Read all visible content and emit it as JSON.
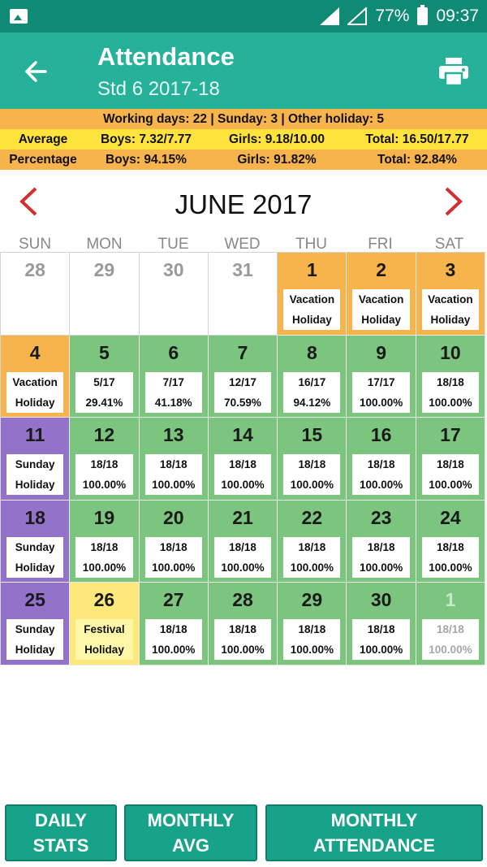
{
  "status": {
    "battery": "77%",
    "time": "09:37"
  },
  "app": {
    "title": "Attendance",
    "subtitle": "Std 6 2017-18"
  },
  "stats": {
    "summary": "Working days: 22 | Sunday: 3 | Other holiday: 5",
    "average": {
      "label": "Average",
      "boys": "Boys: 7.32/7.77",
      "girls": "Girls: 9.18/10.00",
      "total": "Total: 16.50/17.77"
    },
    "percentage": {
      "label": "Percentage",
      "boys": "Boys: 94.15%",
      "girls": "Girls: 91.82%",
      "total": "Total: 92.84%"
    }
  },
  "calendar": {
    "month": "JUNE 2017",
    "weekdays": [
      "SUN",
      "MON",
      "TUE",
      "WED",
      "THU",
      "FRI",
      "SAT"
    ],
    "colors": {
      "holiday": "#f7b44c",
      "present": "#7cc57e",
      "sunday": "#9373c9",
      "festival": "#fde97b",
      "header": "#26b29a",
      "status": "#0f8a74",
      "arrow": "#d32f2f"
    },
    "days": [
      {
        "day": "28",
        "type": "white",
        "l1": "",
        "l2": ""
      },
      {
        "day": "29",
        "type": "white",
        "l1": "",
        "l2": ""
      },
      {
        "day": "30",
        "type": "white",
        "l1": "",
        "l2": ""
      },
      {
        "day": "31",
        "type": "white",
        "l1": "",
        "l2": ""
      },
      {
        "day": "1",
        "type": "orange",
        "l1": "Vacation",
        "l2": "Holiday"
      },
      {
        "day": "2",
        "type": "orange",
        "l1": "Vacation",
        "l2": "Holiday"
      },
      {
        "day": "3",
        "type": "orange",
        "l1": "Vacation",
        "l2": "Holiday"
      },
      {
        "day": "4",
        "type": "orange",
        "l1": "Vacation",
        "l2": "Holiday"
      },
      {
        "day": "5",
        "type": "green",
        "l1": "5/17",
        "l2": "29.41%"
      },
      {
        "day": "6",
        "type": "green",
        "l1": "7/17",
        "l2": "41.18%"
      },
      {
        "day": "7",
        "type": "green",
        "l1": "12/17",
        "l2": "70.59%"
      },
      {
        "day": "8",
        "type": "green",
        "l1": "16/17",
        "l2": "94.12%"
      },
      {
        "day": "9",
        "type": "green",
        "l1": "17/17",
        "l2": "100.00%"
      },
      {
        "day": "10",
        "type": "green",
        "l1": "18/18",
        "l2": "100.00%"
      },
      {
        "day": "11",
        "type": "purple",
        "l1": "Sunday",
        "l2": "Holiday"
      },
      {
        "day": "12",
        "type": "green",
        "l1": "18/18",
        "l2": "100.00%"
      },
      {
        "day": "13",
        "type": "green",
        "l1": "18/18",
        "l2": "100.00%"
      },
      {
        "day": "14",
        "type": "green",
        "l1": "18/18",
        "l2": "100.00%"
      },
      {
        "day": "15",
        "type": "green",
        "l1": "18/18",
        "l2": "100.00%"
      },
      {
        "day": "16",
        "type": "green",
        "l1": "18/18",
        "l2": "100.00%"
      },
      {
        "day": "17",
        "type": "green",
        "l1": "18/18",
        "l2": "100.00%"
      },
      {
        "day": "18",
        "type": "purple",
        "l1": "Sunday",
        "l2": "Holiday"
      },
      {
        "day": "19",
        "type": "green",
        "l1": "18/18",
        "l2": "100.00%"
      },
      {
        "day": "20",
        "type": "green",
        "l1": "18/18",
        "l2": "100.00%"
      },
      {
        "day": "21",
        "type": "green",
        "l1": "18/18",
        "l2": "100.00%"
      },
      {
        "day": "22",
        "type": "green",
        "l1": "18/18",
        "l2": "100.00%"
      },
      {
        "day": "23",
        "type": "green",
        "l1": "18/18",
        "l2": "100.00%"
      },
      {
        "day": "24",
        "type": "green",
        "l1": "18/18",
        "l2": "100.00%"
      },
      {
        "day": "25",
        "type": "purple",
        "l1": "Sunday",
        "l2": "Holiday"
      },
      {
        "day": "26",
        "type": "yellow",
        "l1": "Festival",
        "l2": "Holiday"
      },
      {
        "day": "27",
        "type": "green",
        "l1": "18/18",
        "l2": "100.00%"
      },
      {
        "day": "28",
        "type": "green",
        "l1": "18/18",
        "l2": "100.00%"
      },
      {
        "day": "29",
        "type": "green",
        "l1": "18/18",
        "l2": "100.00%"
      },
      {
        "day": "30",
        "type": "green",
        "l1": "18/18",
        "l2": "100.00%"
      },
      {
        "day": "1",
        "type": "green",
        "dim": true,
        "l1": "18/18",
        "l2": "100.00%"
      }
    ]
  },
  "buttons": {
    "daily": [
      "DAILY",
      "STATS"
    ],
    "monthly_avg": [
      "MONTHLY",
      "AVG"
    ],
    "monthly_attendance": [
      "MONTHLY",
      "ATTENDANCE"
    ]
  }
}
